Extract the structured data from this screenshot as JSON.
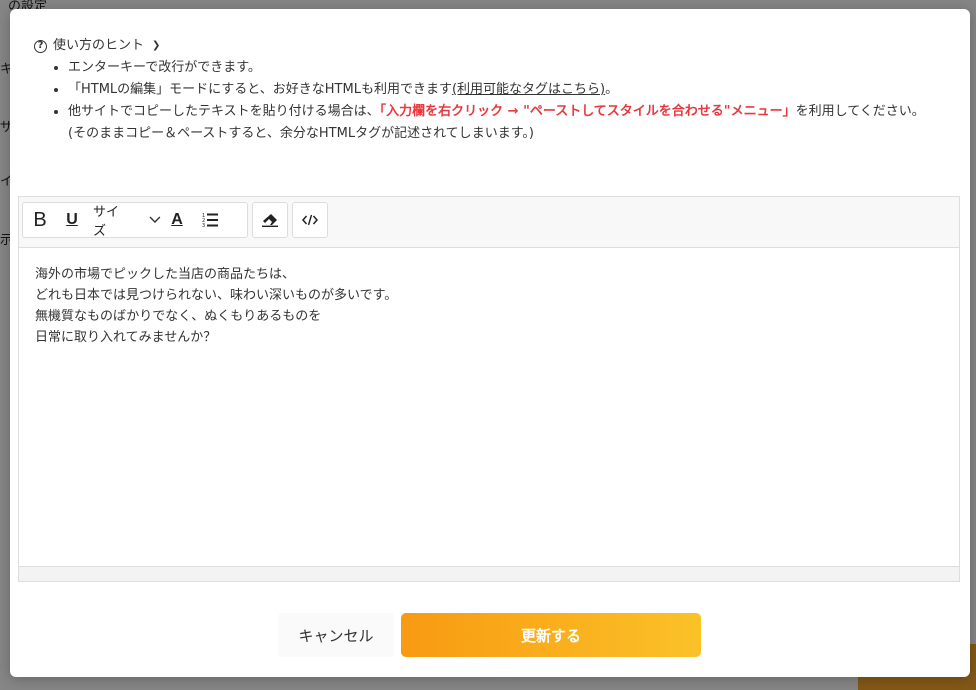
{
  "background": {
    "fragments": [
      "の設定",
      "キ",
      "ザ",
      "イ",
      "示"
    ]
  },
  "hints": {
    "toggle_label": "使い方のヒント",
    "items": [
      {
        "text": "エンターキーで改行ができます。"
      },
      {
        "prefix": "「HTMLの編集」モードにすると、お好きなHTMLも利用できます",
        "link": "(利用可能なタグはこちら)",
        "suffix": "。"
      },
      {
        "prefix": "他サイトでコピーしたテキストを貼り付ける場合は、",
        "emphasis": "「入力欄を右クリック → \"ペーストしてスタイルを合わせる\"メニュー」",
        "suffix": "を利用してください。",
        "note": "(そのままコピー＆ペーストすると、余分なHTMLタグが記述されてしまいます。)"
      }
    ]
  },
  "toolbar": {
    "bold": "B",
    "underline": "U",
    "size_label": "サイズ",
    "color_letter": "A"
  },
  "editor": {
    "lines": [
      "海外の市場でピックした当店の商品たちは、",
      "どれも日本では見つけられない、味わい深いものが多いです。",
      "無機質なものばかりでなく、ぬくもりあるものを",
      "日常に取り入れてみませんか？"
    ]
  },
  "footer": {
    "cancel_label": "キャンセル",
    "update_label": "更新する"
  },
  "colors": {
    "accent_gradient_start": "#f89a12",
    "accent_gradient_end": "#fbc228",
    "warning_text": "#e8383d"
  }
}
